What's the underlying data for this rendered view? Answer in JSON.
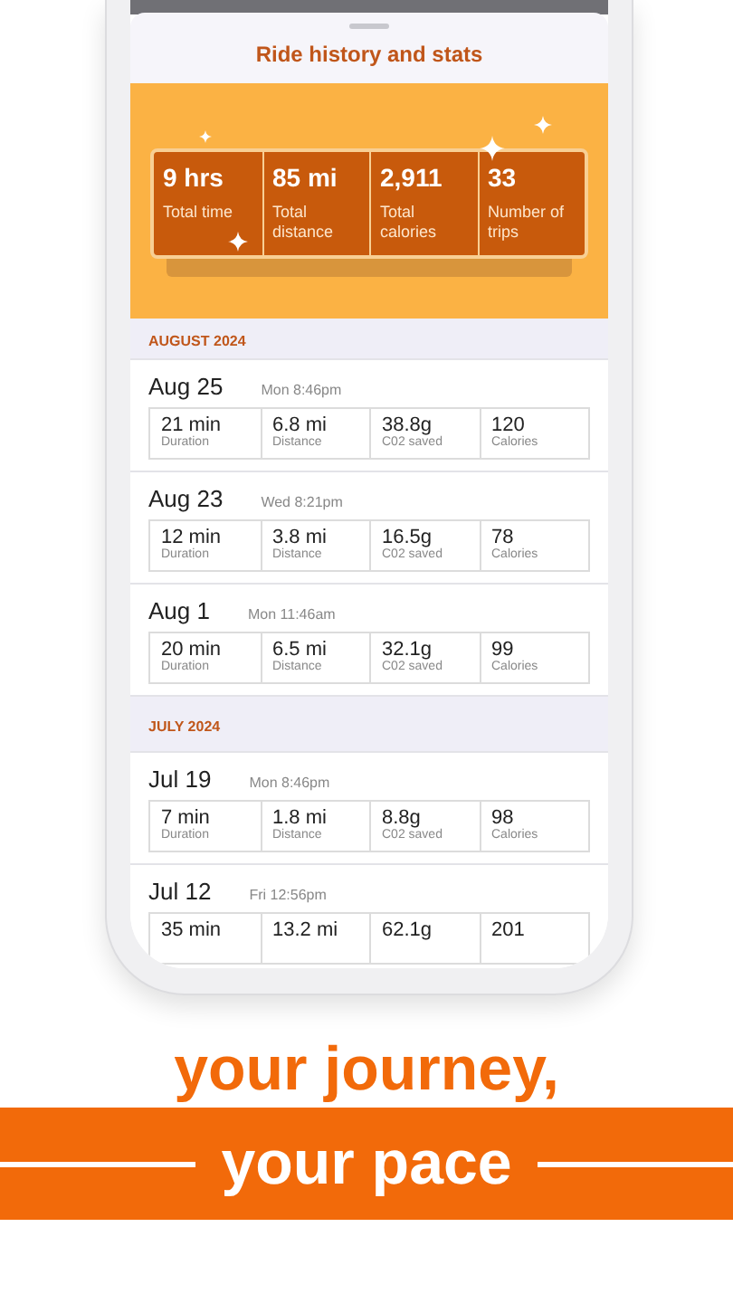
{
  "sheet": {
    "title": "Ride history and stats"
  },
  "totals": [
    {
      "value": "9 hrs",
      "label": "Total time"
    },
    {
      "value": "85 mi",
      "label": "Total distance"
    },
    {
      "value": "2,911",
      "label": "Total calories"
    },
    {
      "value": "33",
      "label": "Number of trips"
    }
  ],
  "months": [
    {
      "heading": "AUGUST 2024",
      "rides": [
        {
          "date": "Aug 25",
          "time": "Mon 8:46pm",
          "stats": [
            {
              "value": "21 min",
              "label": "Duration"
            },
            {
              "value": "6.8 mi",
              "label": "Distance"
            },
            {
              "value": "38.8g",
              "label": "C02 saved"
            },
            {
              "value": "120",
              "label": "Calories"
            }
          ]
        },
        {
          "date": "Aug 23",
          "time": "Wed 8:21pm",
          "stats": [
            {
              "value": "12 min",
              "label": "Duration"
            },
            {
              "value": "3.8 mi",
              "label": "Distance"
            },
            {
              "value": "16.5g",
              "label": "C02 saved"
            },
            {
              "value": "78",
              "label": "Calories"
            }
          ]
        },
        {
          "date": "Aug 1",
          "time": "Mon 11:46am",
          "stats": [
            {
              "value": "20 min",
              "label": "Duration"
            },
            {
              "value": "6.5 mi",
              "label": "Distance"
            },
            {
              "value": "32.1g",
              "label": "C02 saved"
            },
            {
              "value": "99",
              "label": "Calories"
            }
          ]
        }
      ]
    },
    {
      "heading": "JULY 2024",
      "rides": [
        {
          "date": "Jul 19",
          "time": "Mon 8:46pm",
          "stats": [
            {
              "value": "7 min",
              "label": "Duration"
            },
            {
              "value": "1.8 mi",
              "label": "Distance"
            },
            {
              "value": "8.8g",
              "label": "C02 saved"
            },
            {
              "value": "98",
              "label": "Calories"
            }
          ]
        },
        {
          "date": "Jul 12",
          "time": "Fri 12:56pm",
          "stats": [
            {
              "value": "35 min"
            },
            {
              "value": "13.2 mi"
            },
            {
              "value": "62.1g"
            },
            {
              "value": "201"
            }
          ]
        }
      ]
    }
  ],
  "tagline": {
    "line_1": "your journey,",
    "line_2": "your pace"
  }
}
